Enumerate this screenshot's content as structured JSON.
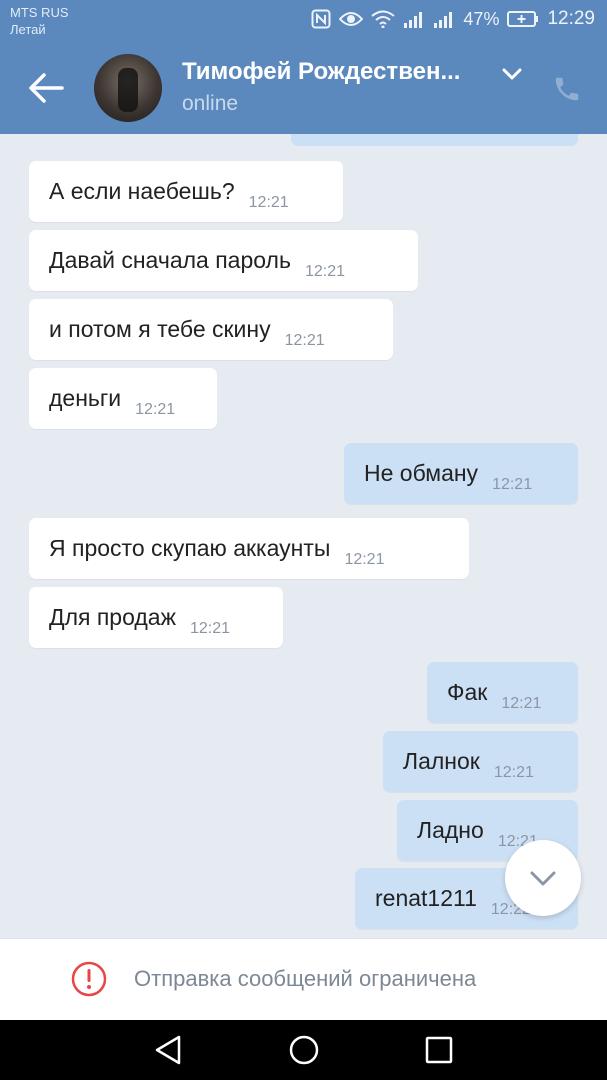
{
  "status_bar": {
    "carrier": "MTS RUS",
    "operator": "Летай",
    "battery_percent": "47%",
    "time": "12:29",
    "icons": [
      "nfc-icon",
      "eye-icon",
      "wifi-icon",
      "signal-icon",
      "signal-icon",
      "battery-charging-icon"
    ]
  },
  "header": {
    "contact_name": "Тимофей Рождествен...",
    "presence": "online",
    "back_icon": "arrow-left-icon",
    "menu_icon": "chevron-down-icon",
    "call_icon": "phone-icon"
  },
  "messages": [
    {
      "dir": "in",
      "text": "А если наебешь?",
      "time": "12:21"
    },
    {
      "dir": "in",
      "text": "Давай сначала пароль",
      "time": "12:21"
    },
    {
      "dir": "in",
      "text": "и потом я тебе скину",
      "time": "12:21"
    },
    {
      "dir": "in",
      "text": "деньги",
      "time": "12:21"
    },
    {
      "dir": "out",
      "text": "Не обману",
      "time": "12:21"
    },
    {
      "dir": "in",
      "text": "Я просто скупаю аккаунты",
      "time": "12:21"
    },
    {
      "dir": "in",
      "text": "Для продаж",
      "time": "12:21"
    },
    {
      "dir": "out",
      "text": "Фак",
      "time": "12:21"
    },
    {
      "dir": "out",
      "text": "Лалнок",
      "time": "12:21"
    },
    {
      "dir": "out",
      "text": "Ладно",
      "time": "12:21"
    },
    {
      "dir": "out",
      "text": "renat1211",
      "time": "12:22"
    }
  ],
  "restriction": {
    "text": "Отправка сообщений ограничена",
    "icon": "warning-circle-icon"
  },
  "colors": {
    "header": "#5b88bd",
    "chat_background": "#e6ebf2",
    "incoming_bubble": "#ffffff",
    "outgoing_bubble": "#cce0f5",
    "warning": "#e64646"
  }
}
